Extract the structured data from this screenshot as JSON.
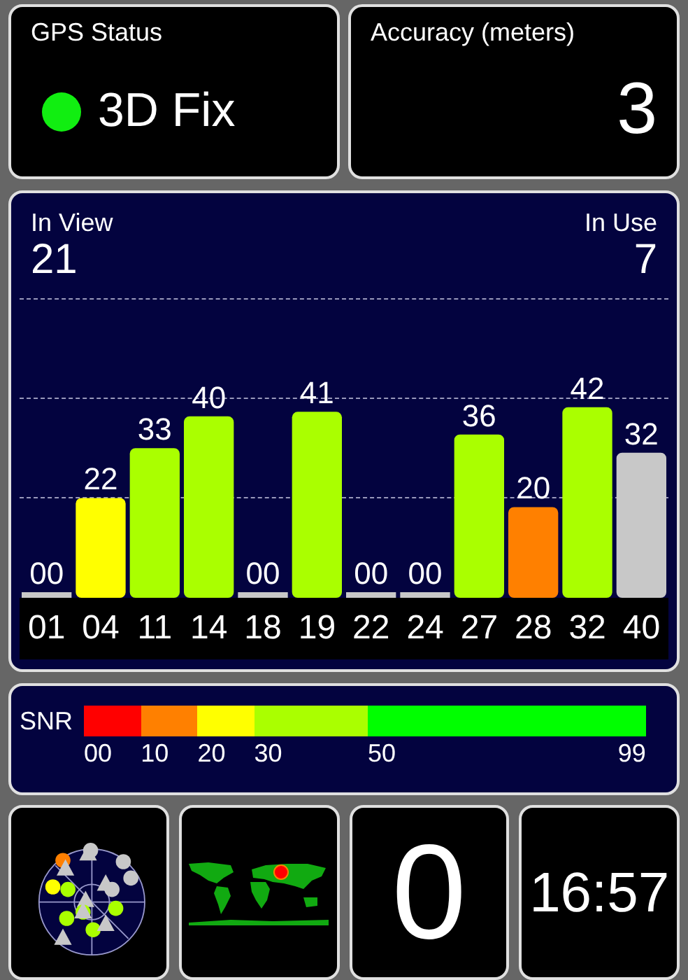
{
  "gps_status": {
    "label": "GPS Status",
    "fix": "3D Fix",
    "status_dot": {
      "color": "#11ee11"
    }
  },
  "accuracy": {
    "label": "Accuracy (meters)",
    "value": "3"
  },
  "signal": {
    "in_view": {
      "label": "In View",
      "value": "21"
    },
    "in_use": {
      "label": "In Use",
      "value": "7"
    },
    "satellites": [
      {
        "id": "01",
        "snr": "00",
        "in_use": false
      },
      {
        "id": "04",
        "snr": "22",
        "in_use": true
      },
      {
        "id": "11",
        "snr": "33",
        "in_use": true
      },
      {
        "id": "14",
        "snr": "40",
        "in_use": true
      },
      {
        "id": "18",
        "snr": "00",
        "in_use": false
      },
      {
        "id": "19",
        "snr": "41",
        "in_use": true
      },
      {
        "id": "22",
        "snr": "00",
        "in_use": false
      },
      {
        "id": "24",
        "snr": "00",
        "in_use": false
      },
      {
        "id": "27",
        "snr": "36",
        "in_use": true
      },
      {
        "id": "28",
        "snr": "20",
        "in_use": true
      },
      {
        "id": "32",
        "snr": "42",
        "in_use": true
      },
      {
        "id": "40",
        "snr": "32",
        "in_use": false
      }
    ]
  },
  "snr_scale": {
    "label": "SNR",
    "segments": [
      {
        "label": "00",
        "color": "#ff0000"
      },
      {
        "label": "10",
        "color": "#ff8000"
      },
      {
        "label": "20",
        "color": "#ffff00"
      },
      {
        "label": "30",
        "color": "#aaff00"
      },
      {
        "label": "50",
        "color": "#00ff00"
      }
    ],
    "end_label": "99"
  },
  "tile_3": {
    "value": "0"
  },
  "clock": {
    "time": "16:57"
  }
}
